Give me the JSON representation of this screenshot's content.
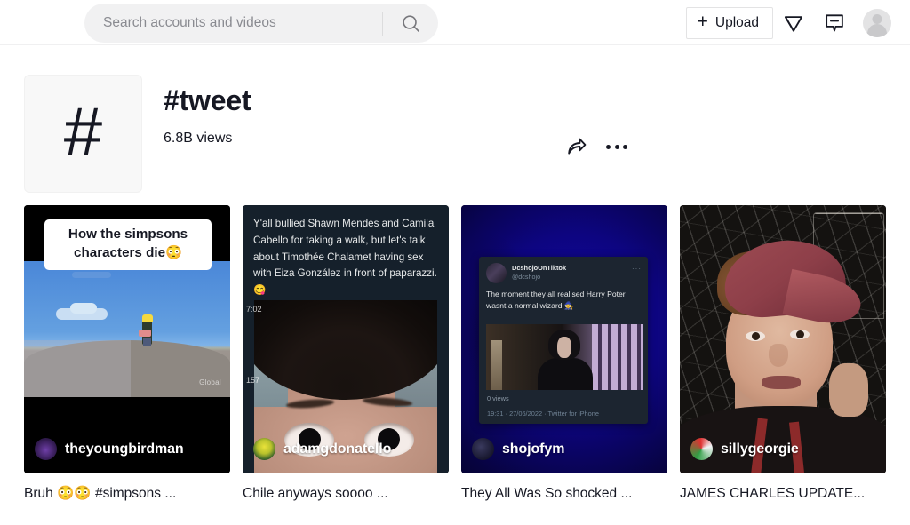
{
  "header": {
    "search": {
      "placeholder": "Search accounts and videos",
      "value": "",
      "icon": "search-icon"
    },
    "upload_label": "Upload",
    "upload_plus": "+",
    "icons": {
      "send": "paper-plane-icon",
      "messages": "message-icon",
      "avatar": "avatar-icon"
    }
  },
  "tag": {
    "hash_glyph": "#",
    "title": "#tweet",
    "views": "6.8B views",
    "share_icon": "share-arrow-icon",
    "more_icon": "more-options-icon"
  },
  "videos": [
    {
      "username": "theyoungbirdman",
      "caption_plain": "Bruh 😳😳 ",
      "caption_tag": "#simpsons",
      "caption_tail": " ...",
      "caption_full": "Bruh 😳😳 #simpsons ...",
      "overlay_text_line1": "How the simpsons",
      "overlay_text_line2": "characters die😳",
      "watermark": "Global"
    },
    {
      "username": "adamgdonatello",
      "caption_full": "Chile anyways soooo ...",
      "tweet_text": "Y'all bullied Shawn Mendes and Camila Cabello for taking a walk, but let's talk about Timothée Chalamet having sex with Eiza González in front of paparazzi. 😋",
      "timestamp_overlay": "7:02",
      "counter_overlay": "157"
    },
    {
      "username": "shojofym",
      "caption_full": "They All Was So shocked ...",
      "tweet": {
        "display_name": "DcshojoOnTiktok",
        "handle": "@dcshojo",
        "body": "The moment they all realised Harry Poter wasnt a normal wizard 🧙",
        "views": "0 views",
        "meta": "19:31 · 27/06/2022 · Twitter for iPhone",
        "more": "···"
      }
    },
    {
      "username": "sillygeorgie",
      "caption_full": "JAMES CHARLES UPDATE..."
    }
  ],
  "colors": {
    "text": "#161823",
    "muted": "#8a8b91",
    "search_bg": "#f1f1f2",
    "border": "#e3e3e4"
  }
}
